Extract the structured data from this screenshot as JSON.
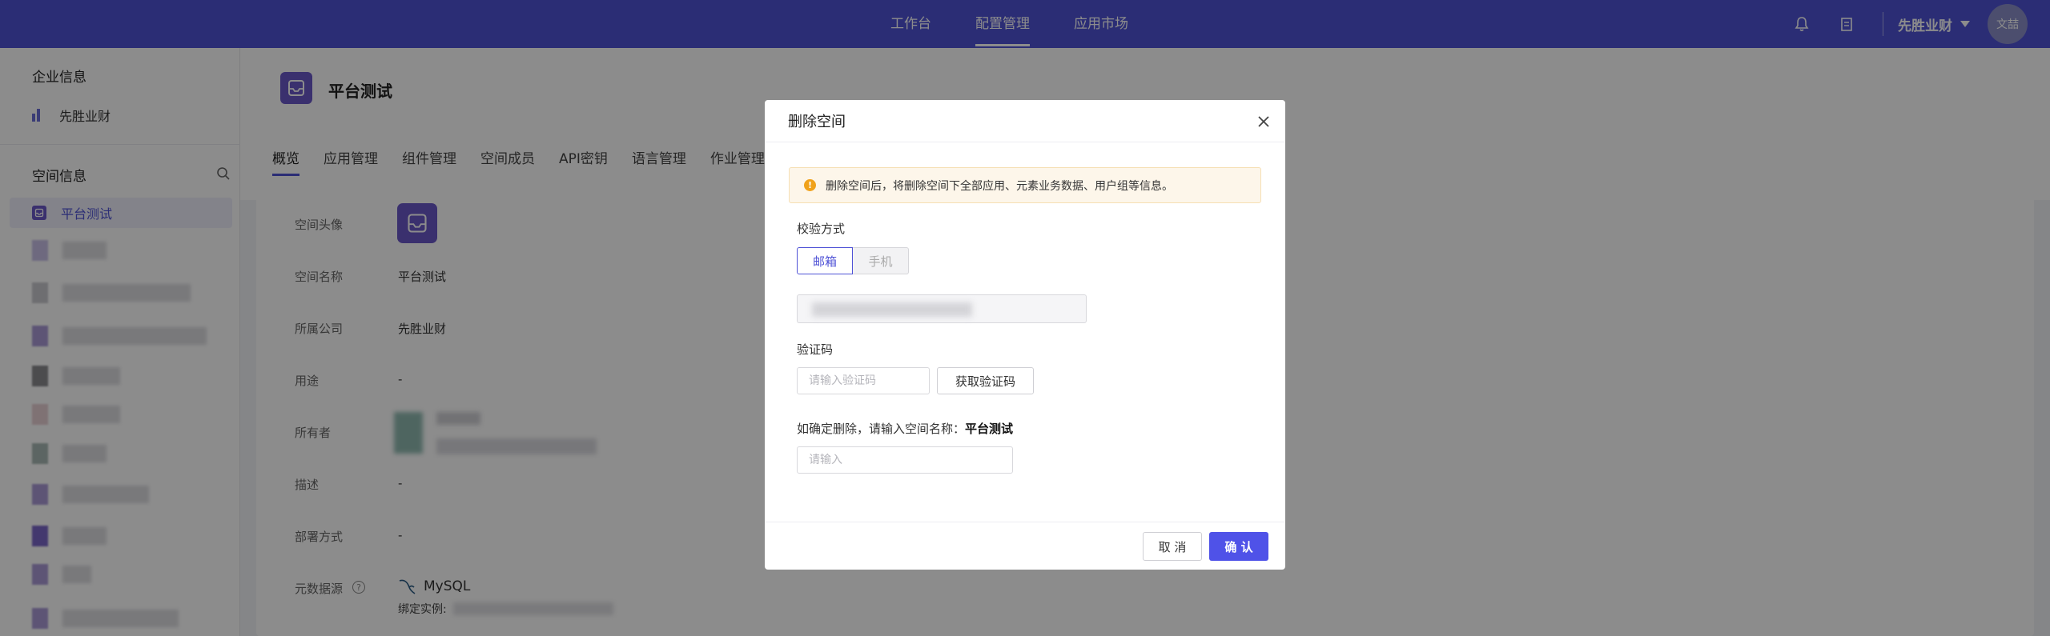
{
  "topnav": {
    "items": [
      {
        "label": "工作台"
      },
      {
        "label": "配置管理",
        "active": true
      },
      {
        "label": "应用市场"
      }
    ],
    "company": "先胜业财",
    "user_initials": "文喆",
    "icons": [
      "bell-icon",
      "document-icon",
      "chevron-down-icon"
    ]
  },
  "sidebar": {
    "enterprise_title": "企业信息",
    "company_name": "先胜业财",
    "space_title": "空间信息",
    "active_item": "平台测试"
  },
  "header": {
    "title": "平台测试",
    "tabs": [
      "概览",
      "应用管理",
      "组件管理",
      "空间成员",
      "API密钥",
      "语言管理",
      "作业管理"
    ]
  },
  "details": {
    "avatar_label": "空间头像",
    "name_label": "空间名称",
    "name_value": "平台测试",
    "company_label": "所属公司",
    "company_value": "先胜业财",
    "usage_label": "用途",
    "usage_value": "-",
    "owner_label": "所有者",
    "desc_label": "描述",
    "desc_value": "-",
    "deploy_label": "部署方式",
    "deploy_value": "-",
    "datasource_label": "元数据源",
    "datasource_value": "MySQL",
    "bind_label": "绑定实例:"
  },
  "modal": {
    "title": "删除空间",
    "alert": "删除空间后，将删除空间下全部应用、元素业务数据、用户组等信息。",
    "verify_label": "校验方式",
    "verify_options": [
      "邮箱",
      "手机"
    ],
    "verify_selected": "邮箱",
    "code_label": "验证码",
    "code_placeholder": "请输入验证码",
    "get_code": "获取验证码",
    "confirm_prefix": "如确定删除，请输入空间名称：",
    "confirm_name": "平台测试",
    "confirm_placeholder": "请输入",
    "cancel": "取 消",
    "ok": "确 认"
  },
  "colors": {
    "brand": "#4f52d6",
    "primary_button": "#4f52e8",
    "warning": "#f0a21b",
    "space_icon": "#6b58c8"
  }
}
